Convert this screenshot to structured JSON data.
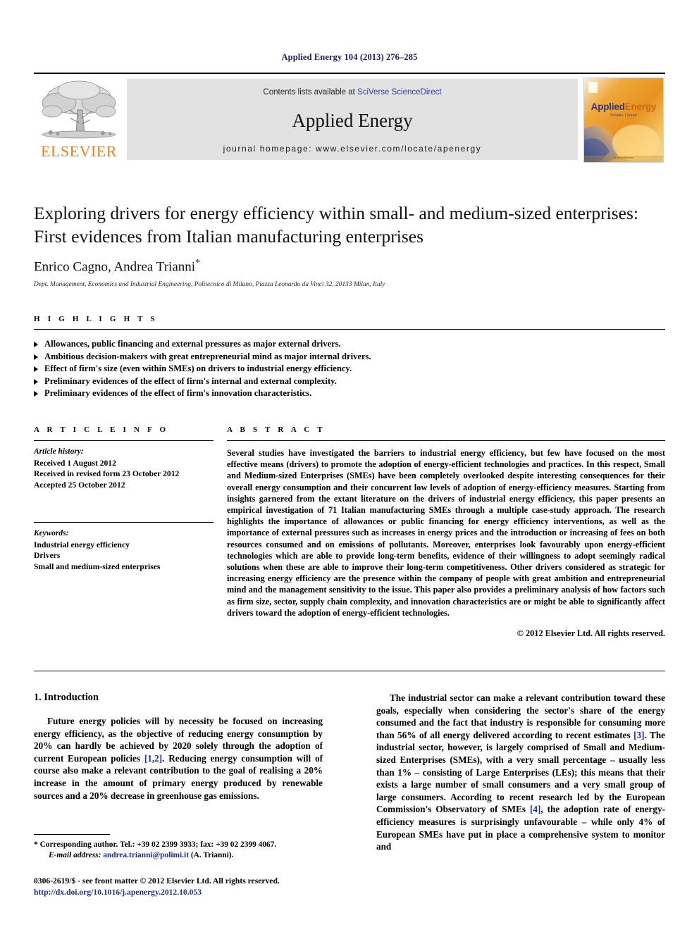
{
  "running_head": "Applied Energy 104 (2013) 276–285",
  "masthead": {
    "publisher_wordmark": "ELSEVIER",
    "contents_prefix": "Contents lists available at ",
    "contents_link": "SciVerse ScienceDirect",
    "journal_name": "Applied Energy",
    "homepage": "journal homepage: www.elsevier.com/locate/apenergy",
    "cover": {
      "title_part1": "Applied",
      "title_part2": "Energy",
      "subtitle": "Volume | Issue",
      "footer": "ScienceDirect"
    }
  },
  "article": {
    "title": "Exploring drivers for energy efficiency within small- and medium-sized enterprises: First evidences from Italian manufacturing enterprises",
    "authors": "Enrico Cagno, Andrea Trianni",
    "corresponding_marker": "*",
    "affiliation": "Dept. Management, Economics and Industrial Engineering, Politecnico di Milano, Piazza Leonardo da Vinci 32, 20133 Milan, Italy"
  },
  "highlights": {
    "heading": "H I G H L I G H T S",
    "items": [
      "Allowances, public financing and external pressures as major external drivers.",
      "Ambitious decision-makers with great entrepreneurial mind as major internal drivers.",
      "Effect of firm's size (even within SMEs) on drivers to industrial energy efficiency.",
      "Preliminary evidences of the effect of firm's internal and external complexity.",
      "Preliminary evidences of the effect of firm's innovation characteristics."
    ]
  },
  "article_info": {
    "heading": "A R T I C L E   I N F O",
    "history_label": "Article history:",
    "history": [
      "Received 1 August 2012",
      "Received in revised form 23 October 2012",
      "Accepted 25 October 2012"
    ],
    "keywords_label": "Keywords:",
    "keywords": [
      "Industrial energy efficiency",
      "Drivers",
      "Small and medium-sized enterprises"
    ]
  },
  "abstract": {
    "heading": "A B S T R A C T",
    "text": "Several studies have investigated the barriers to industrial energy efficiency, but few have focused on the most effective means (drivers) to promote the adoption of energy-efficient technologies and practices. In this respect, Small and Medium-sized Enterprises (SMEs) have been completely overlooked despite interesting consequences for their overall energy consumption and their concurrent low levels of adoption of energy-efficiency measures. Starting from insights garnered from the extant literature on the drivers of industrial energy efficiency, this paper presents an empirical investigation of 71 Italian manufacturing SMEs through a multiple case-study approach. The research highlights the importance of allowances or public financing for energy efficiency interventions, as well as the importance of external pressures such as increases in energy prices and the introduction or increasing of fees on both resources consumed and on emissions of pollutants. Moreover, enterprises look favourably upon energy-efficient technologies which are able to provide long-term benefits, evidence of their willingness to adopt seemingly radical solutions when these are able to improve their long-term competitiveness. Other drivers considered as strategic for increasing energy efficiency are the presence within the company of people with great ambition and entrepreneurial mind and the management sensitivity to the issue. This paper also provides a preliminary analysis of how factors such as firm size, sector, supply chain complexity, and innovation characteristics are or might be able to significantly affect drivers toward the adoption of energy-efficient technologies.",
    "copyright": "© 2012 Elsevier Ltd. All rights reserved."
  },
  "body": {
    "section_title": "1. Introduction",
    "left_para_1": "Future energy policies will by necessity be focused on increasing energy efficiency, as the objective of reducing energy consumption by 20% can hardly be achieved by 2020 solely through the adoption of current European policies ",
    "left_cite_1": "[1,2]",
    "left_para_1b": ". Reducing energy consumption will of course also make a relevant contribution to the goal of realising a 20% increase in the amount of primary energy produced by renewable sources and a 20% decrease in greenhouse gas emissions.",
    "right_para_1": "The industrial sector can make a relevant contribution toward these goals, especially when considering the sector's share of the energy consumed and the fact that industry is responsible for consuming more than 56% of all energy delivered according to recent estimates ",
    "right_cite_1": "[3]",
    "right_para_1b": ". The industrial sector, however, is largely comprised of Small and Medium-sized Enterprises (SMEs), with a very small percentage – usually less than 1% – consisting of Large Enterprises (LEs); this means that their exists a large number of small consumers and a very small group of large consumers. According to recent research led by the European Commission's Observatory of SMEs ",
    "right_cite_2": "[4]",
    "right_para_1c": ", the adoption rate of energy-efficiency measures is surprisingly unfavourable – while only 4% of European SMEs have put in place a comprehensive system to monitor and"
  },
  "footnote": {
    "marker": "*",
    "corresponding": "Corresponding author. Tel.: +39 02 2399 3933; fax: +39 02 2399 4067.",
    "email_label": "E-mail address:",
    "email": "andrea.trianni@polimi.it",
    "email_suffix": "(A. Trianni)."
  },
  "footer": {
    "issn_line": "0306-2619/$ - see front matter © 2012 Elsevier Ltd. All rights reserved.",
    "doi": "http://dx.doi.org/10.1016/j.apenergy.2012.10.053"
  },
  "colors": {
    "link": "#1b2f96",
    "elsevier_orange": "#ef7d20",
    "running_head": "#1b1b64",
    "band": "#e2e2e2"
  }
}
